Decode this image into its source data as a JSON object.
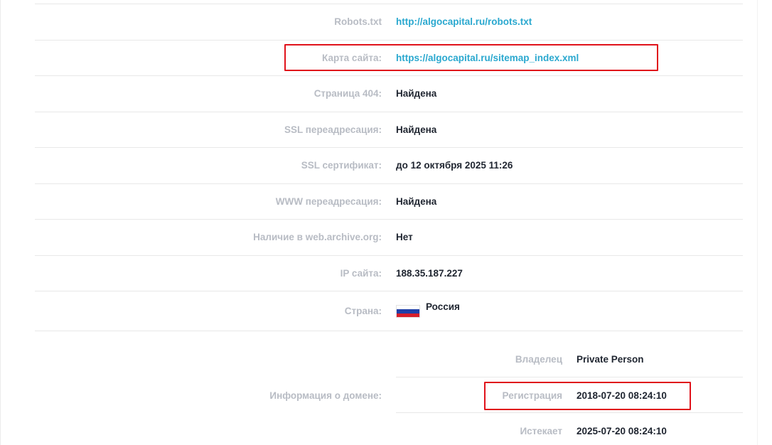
{
  "rows": [
    {
      "label": "Robots.txt",
      "value": "http://algocapital.ru/robots.txt",
      "is_link": true
    },
    {
      "label": "Карта сайта:",
      "value": "https://algocapital.ru/sitemap_index.xml",
      "is_link": true
    },
    {
      "label": "Страница 404:",
      "value": "Найдена"
    },
    {
      "label": "SSL переадресация:",
      "value": "Найдена"
    },
    {
      "label": "SSL сертификат:",
      "value": "до 12 октября 2025 11:26"
    },
    {
      "label": "WWW переадресация:",
      "value": "Найдена"
    },
    {
      "label": "Наличие в web.archive.org:",
      "value": "Нет"
    },
    {
      "label": "IP сайта:",
      "value": "188.35.187.227"
    },
    {
      "label": "Страна:",
      "value": "Россия",
      "flag_icon": "russia-flag-icon"
    }
  ],
  "domain_info": {
    "label": "Информация о домене:",
    "items": [
      {
        "label": "Владелец",
        "value": "Private Person"
      },
      {
        "label": "Регистрация",
        "value": "2018-07-20 08:24:10"
      },
      {
        "label": "Истекает",
        "value": "2025-07-20 08:24:10"
      }
    ]
  },
  "colors": {
    "link": "#2aa8cf",
    "label": "#b8bcc4",
    "value": "#1f2530",
    "highlight": "#e0121b"
  }
}
